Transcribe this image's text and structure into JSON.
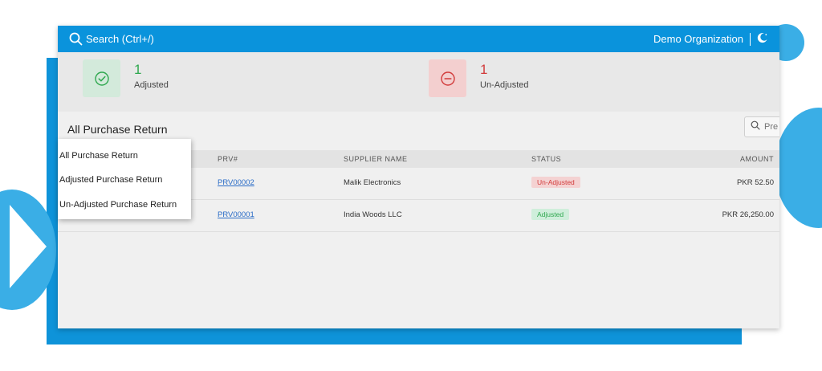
{
  "topbar": {
    "search_label": "Search (Ctrl+/)",
    "organization": "Demo Organization",
    "theme_icon": "moon-icon"
  },
  "stats": {
    "adjusted": {
      "count": "1",
      "label": "Adjusted",
      "icon": "check-circle-icon",
      "color": "#2fa84f"
    },
    "unadjusted": {
      "count": "1",
      "label": "Un-Adjusted",
      "icon": "minus-circle-icon",
      "color": "#d23b3b"
    }
  },
  "list": {
    "title": "All Purchase Return",
    "search_placeholder": "Pre"
  },
  "filter_menu": {
    "items": [
      "All Purchase Return",
      "Adjusted Purchase Return",
      "Un-Adjusted Purchase Return"
    ]
  },
  "table": {
    "headers": {
      "prv": "PRV#",
      "supplier": "SUPPLIER NAME",
      "status": "STATUS",
      "amount": "AMOUNT"
    },
    "rows": [
      {
        "prv": "PRV00002",
        "supplier": "Malik Electronics",
        "status": "Un-Adjusted",
        "amount": "PKR 52.50"
      },
      {
        "prv": "PRV00001",
        "supplier": "India Woods LLC",
        "status": "Adjusted",
        "amount": "PKR 26,250.00"
      }
    ]
  },
  "colors": {
    "brand": "#0a93dc",
    "success": "#2fa84f",
    "danger": "#d23b3b"
  }
}
